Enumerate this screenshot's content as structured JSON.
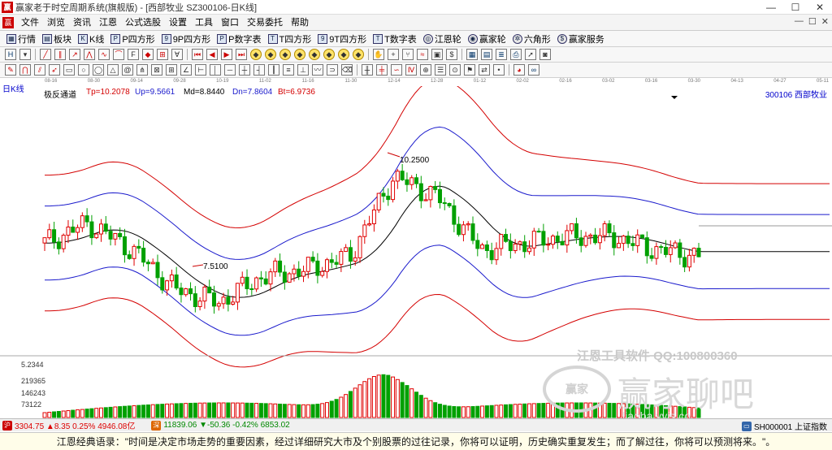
{
  "window": {
    "logo_glyph": "赢",
    "title": "赢家老于时空周期系统(旗舰版) - [西部牧业  SZ300106-日K线]",
    "controls": [
      "—",
      "☐",
      "✕"
    ]
  },
  "menu": {
    "logo_glyph": "赢",
    "items": [
      "文件",
      "浏览",
      "资讯",
      "江恩",
      "公式选股",
      "设置",
      "工具",
      "窗口",
      "交易委托",
      "帮助"
    ],
    "right_controls": [
      "—",
      "☐",
      "✕"
    ]
  },
  "toolbar1": [
    {
      "label": "行情",
      "icon": "grid-icon"
    },
    {
      "label": "板块",
      "icon": "blocks-icon"
    },
    {
      "label": "K线",
      "icon": "k-icon"
    },
    {
      "label": "P四方形",
      "icon": "p-square-icon"
    },
    {
      "label": "9P四方形",
      "icon": "9p-square-icon"
    },
    {
      "label": "P数字表",
      "icon": "p-table-icon"
    },
    {
      "label": "T四方形",
      "icon": "t-square-icon"
    },
    {
      "label": "9T四方形",
      "icon": "9t-square-icon"
    },
    {
      "label": "T数字表",
      "icon": "t-table-icon"
    },
    {
      "label": "江恩轮",
      "icon": "gann-wheel-icon"
    },
    {
      "label": "赢家轮",
      "icon": "winner-wheel-icon"
    },
    {
      "label": "六角形",
      "icon": "hexagon-icon"
    },
    {
      "label": "赢家服务",
      "icon": "service-icon"
    }
  ],
  "date_axis": [
    "08-16",
    "08-30",
    "09-14",
    "09-28",
    "10-19",
    "11-02",
    "11-16",
    "11-30",
    "12-14",
    "12-28",
    "01-12",
    "02-02",
    "02-16",
    "03-02",
    "03-16",
    "03-30",
    "04-13",
    "04-27",
    "05-11"
  ],
  "period_label": "日K线",
  "indicator": {
    "name": "极反通道",
    "tp": "Tp=10.2078",
    "up": "Up=9.5661",
    "md": "Md=8.8440",
    "dn": "Dn=7.8604",
    "bt": "Bt=6.9736"
  },
  "stock": {
    "code": "300106",
    "name": "西部牧业"
  },
  "annotations": {
    "high": "10.2500",
    "low": "7.5100"
  },
  "volume_axis": {
    "labels": [
      "5.2344",
      "219365",
      "146243",
      "73122"
    ]
  },
  "colors": {
    "red_band": "#d40000",
    "blue_band": "#1a1acc",
    "mid": "#000000",
    "up_candle": "#e00000",
    "down_candle": "#00a000"
  },
  "watermark": {
    "line1": "江恩工具软件  QQ:100800360",
    "line2": "赢家聊吧",
    "line3": "liaoba.yyjs.co",
    "badge": "赢家"
  },
  "statusbar": {
    "sh": {
      "icon": "沪",
      "text": "3304.75 ▲8.35 0.25% 4946.08亿"
    },
    "sz": {
      "icon": "深",
      "text": "11839.06 ▼-50.36 -0.42% 6853.02"
    },
    "index_label": "SH000001 上证指数"
  },
  "quote": "江恩经典语录：\"时间是决定市场走势的重要因素，经过详细研究大市及个别股票的过往记录，你将可以证明，历史确实重复发生；而了解过往，你将可以预测将来。\"。",
  "chart_data": {
    "type": "candlestick",
    "x": [
      "08-16",
      "08-30",
      "09-14",
      "09-28",
      "10-19",
      "11-02",
      "11-16",
      "11-30",
      "12-14",
      "12-28",
      "01-12",
      "02-02",
      "02-16",
      "03-02",
      "03-16",
      "03-30"
    ],
    "close": [
      8.6,
      8.9,
      8.5,
      7.9,
      7.7,
      8.1,
      8.2,
      8.4,
      9.6,
      9.3,
      8.5,
      8.6,
      8.7,
      8.7,
      8.5,
      8.4
    ],
    "annotations": [
      "10.2500",
      "7.5100"
    ],
    "bands": [
      "Tp",
      "Up",
      "Md",
      "Dn",
      "Bt"
    ]
  }
}
